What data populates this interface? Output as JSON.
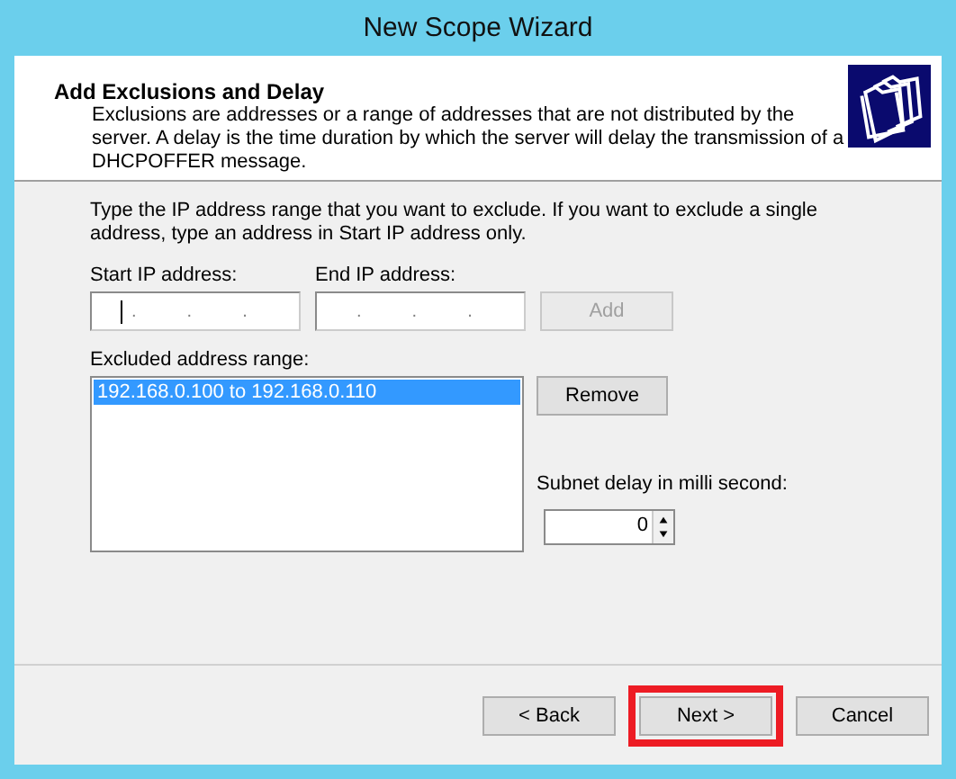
{
  "window": {
    "title": "New Scope Wizard"
  },
  "header": {
    "title": "Add Exclusions and Delay",
    "description": "Exclusions are addresses or a range of addresses that are not distributed by the server. A delay is the time duration by which the server will delay the transmission of a DHCPOFFER message."
  },
  "instructions": "Type the IP address range that you want to exclude. If you want to exclude a single address, type an address in Start IP address only.",
  "start_ip": {
    "label": "Start IP address:",
    "dots": [
      ".",
      ".",
      "."
    ],
    "focused": true
  },
  "end_ip": {
    "label": "End IP address:",
    "dots": [
      ".",
      ".",
      "."
    ],
    "focused": false
  },
  "add_button": {
    "label": "Add",
    "disabled": true
  },
  "excluded": {
    "label": "Excluded address range:",
    "items": [
      {
        "text": "192.168.0.100 to 192.168.0.110",
        "selected": true
      }
    ]
  },
  "remove_button": {
    "label": "Remove",
    "disabled": false
  },
  "subnet_delay": {
    "label": "Subnet delay in milli second:",
    "value": "0"
  },
  "buttons": [
    {
      "label": "< Back",
      "highlighted": false
    },
    {
      "label": "Next >",
      "highlighted": true
    },
    {
      "label": "Cancel",
      "highlighted": false
    }
  ]
}
